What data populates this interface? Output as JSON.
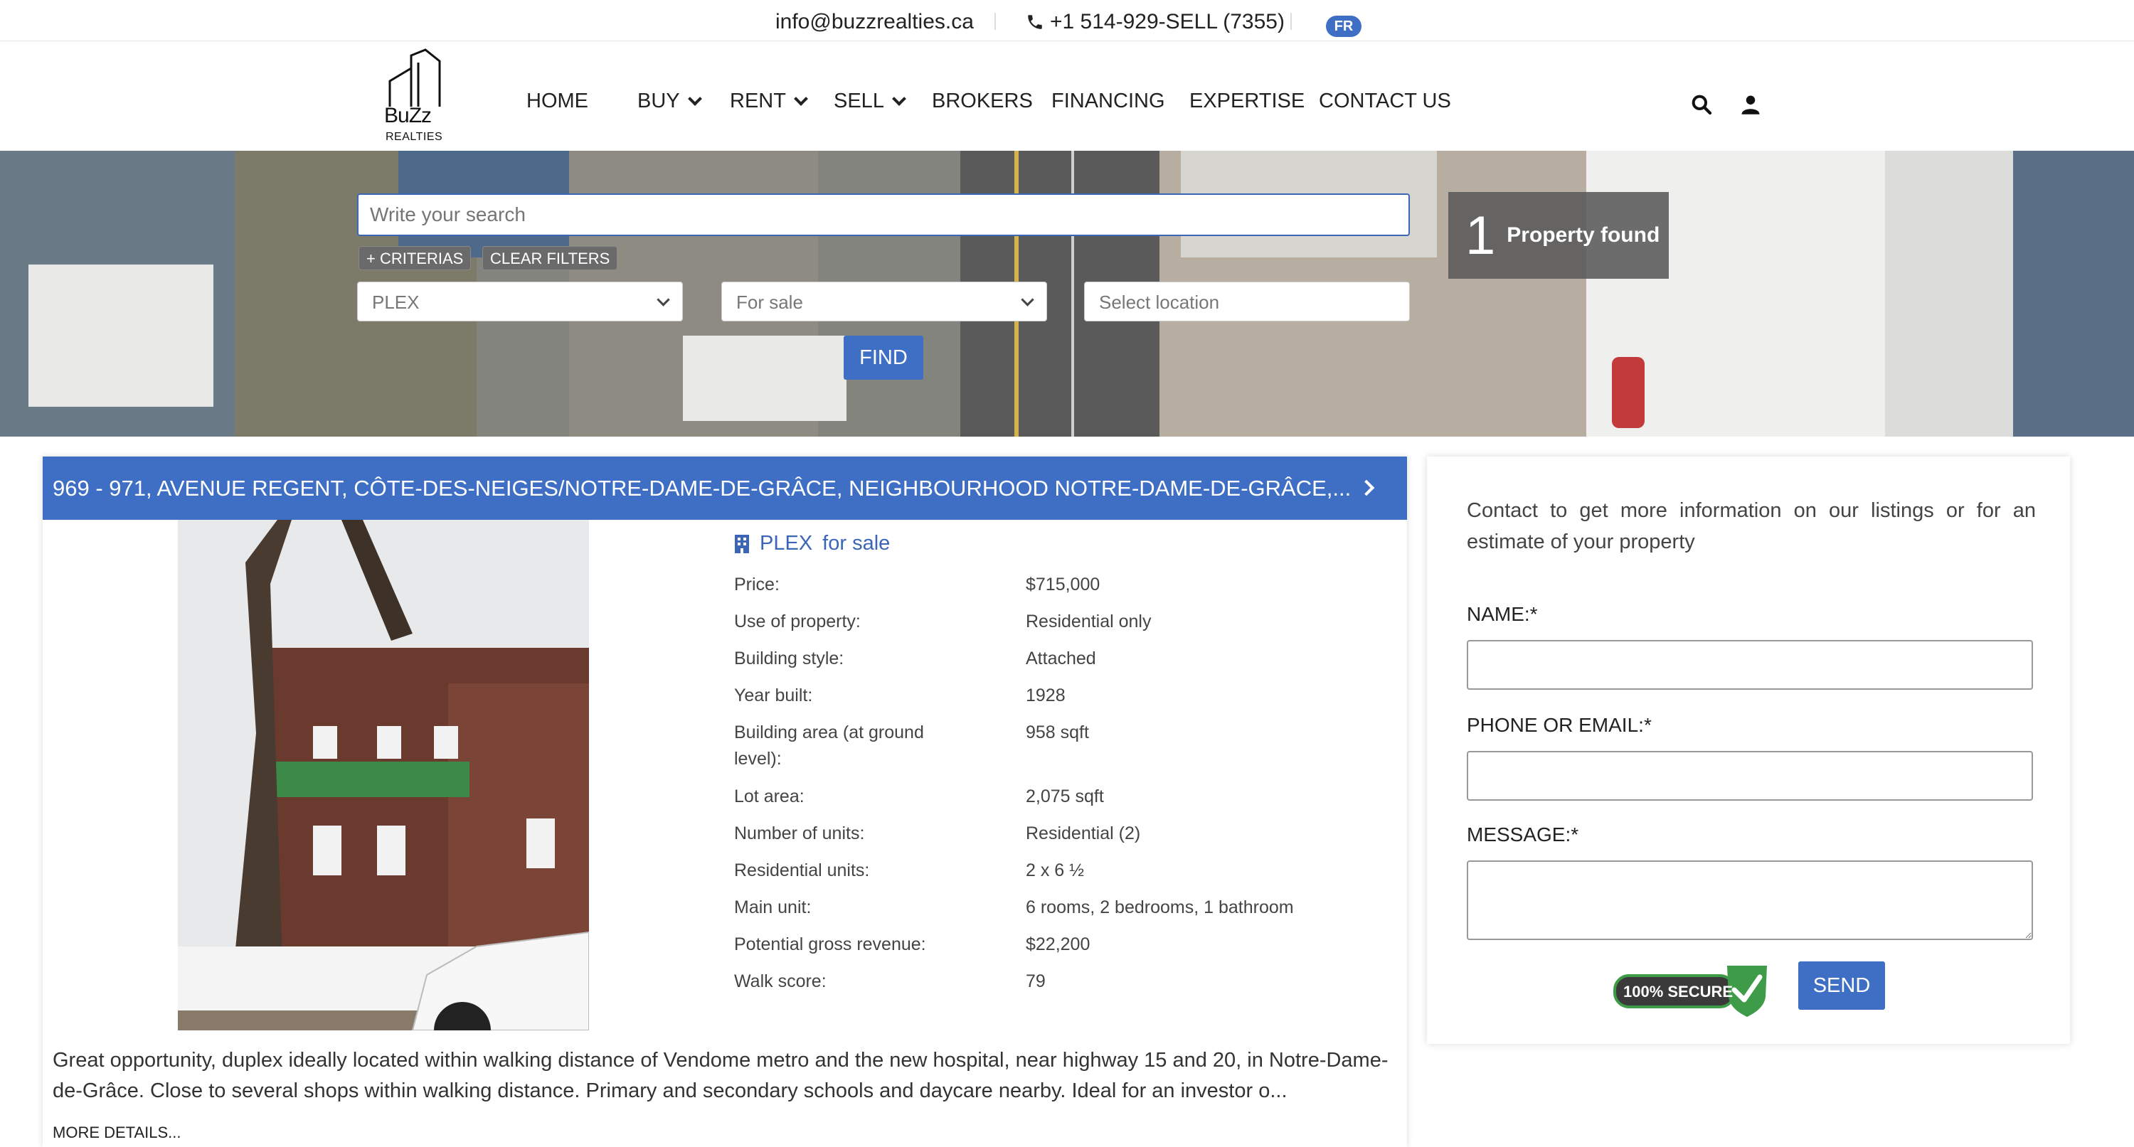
{
  "topbar": {
    "email": "info@buzzrealties.ca",
    "phone": "+1 514-929-SELL (7355)",
    "language": "FR"
  },
  "header": {
    "logo_word": "BuZz",
    "logo_sub": "REALTIES",
    "nav": {
      "home": "HOME",
      "buy": "BUY",
      "rent": "RENT",
      "sell": "SELL",
      "brokers": "BROKERS",
      "financing": "FINANCING",
      "expertise": "EXPERTISE",
      "contact": "CONTACT US"
    },
    "icons": {
      "search": "search-icon",
      "user": "user-icon"
    }
  },
  "search": {
    "placeholder": "Write your search",
    "criterias_label": "+ CRITERIAS",
    "clear_filters_label": "CLEAR FILTERS",
    "type_value": "PLEX",
    "transaction_value": "For sale",
    "location_placeholder": "Select location",
    "find_label": "FIND",
    "found_count": "1",
    "found_label": "Property found"
  },
  "listing": {
    "title": "969 - 971, AVENUE REGENT, CÔTE-DES-NEIGES/NOTRE-DAME-DE-GRÂCE, NEIGHBOURHOOD NOTRE-DAME-DE-GRÂCE,...",
    "type_label": "PLEX",
    "transaction_label": "for sale",
    "details": [
      {
        "label": "Price:",
        "value": "$715,000"
      },
      {
        "label": "Use of property:",
        "value": "Residential only"
      },
      {
        "label": "Building style:",
        "value": "Attached"
      },
      {
        "label": "Year built:",
        "value": "1928"
      },
      {
        "label": "Building area (at ground level):",
        "value": "958 sqft"
      },
      {
        "label": "Lot area:",
        "value": "2,075 sqft"
      },
      {
        "label": "Number of units:",
        "value": "Residential (2)"
      },
      {
        "label": "Residential units:",
        "value": "2 x 6 ½"
      },
      {
        "label": "Main unit:",
        "value": "6 rooms, 2 bedrooms, 1 bathroom"
      },
      {
        "label": "Potential gross revenue:",
        "value": "$22,200"
      },
      {
        "label": "Walk score:",
        "value": "79"
      }
    ],
    "description": "Great opportunity, duplex ideally located within walking distance of Vendome metro and the new hospital, near highway 15 and 20, in Notre-Dame-de-Grâce. Close to several shops within walking distance. Primary and secondary schools and daycare nearby. Ideal for an investor o...",
    "more_details": "MORE DETAILS..."
  },
  "contact": {
    "intro": "Contact to get more information on our listings or for an estimate of your property",
    "name_label": "NAME:*",
    "phone_email_label": "PHONE OR EMAIL:*",
    "message_label": "MESSAGE:*",
    "secure_badge": "100% SECURE",
    "send_label": "SEND"
  },
  "colors": {
    "accent": "#3f6fc4",
    "title_bar": "#3f6fc4"
  }
}
